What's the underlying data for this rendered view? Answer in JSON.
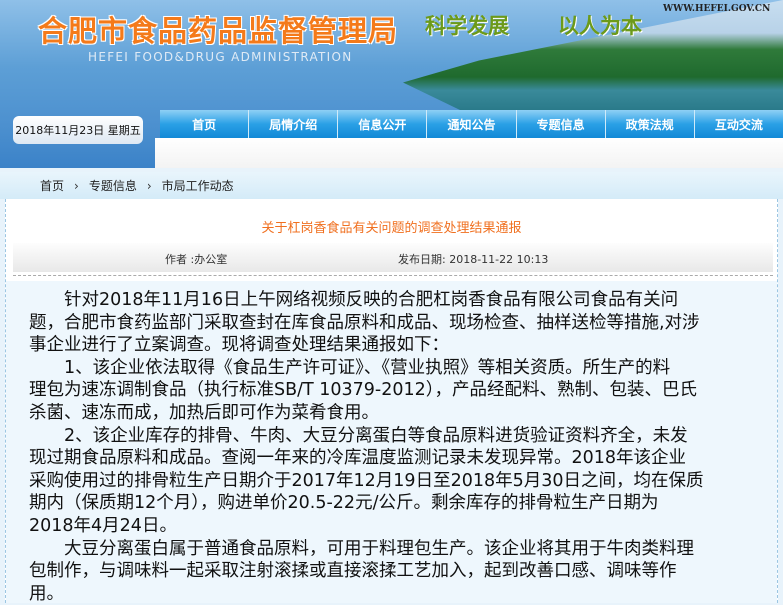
{
  "header": {
    "title": "合肥市食品药品监督管理局",
    "slogan1": "科学发展",
    "slogan2": "以人为本",
    "url": "WWW.HEFEI.GOV.CN",
    "english_title": "HEFEI FOOD&DRUG ADMINISTRATION",
    "date": "2018年11月23日 星期五"
  },
  "nav": [
    "首页",
    "局情介绍",
    "信息公开",
    "通知公告",
    "专题信息",
    "政策法规",
    "互动交流"
  ],
  "breadcrumb": {
    "items": [
      "首页",
      "专题信息",
      "市局工作动态"
    ],
    "separator": "›"
  },
  "article": {
    "title": "关于杠岗香食品有关问题的调查处理结果通报",
    "author": "作者 :办公室",
    "date": "发布日期: 2018-11-22 10:13",
    "lines": [
      "　　针对2018年11月16日上午网络视频反映的合肥杠岗香食品有限公司食品有关问",
      "题，合肥市食药监部门采取查封在库食品原料和成品、现场检查、抽样送检等措施,对涉",
      "事企业进行了立案调查。现将调查处理结果通报如下：",
      "　　1、该企业依法取得《食品生产许可证》、《营业执照》等相关资质。所生产的料",
      "理包为速冻调制食品（执行标准SB/T 10379-2012），产品经配料、熟制、包装、巴氏",
      "杀菌、速冻而成，加热后即可作为菜肴食用。",
      "　　2、该企业库存的排骨、牛肉、大豆分离蛋白等食品原料进货验证资料齐全，未发",
      "现过期食品原料和成品。查阅一年来的冷库温度监测记录未发现异常。2018年该企业",
      "采购使用过的排骨粒生产日期介于2017年12月19日至2018年5月30日之间，均在保质",
      "期内（保质期12个月），购进单价20.5-22元/公斤。剩余库存的排骨粒生产日期为",
      "2018年4月24日。",
      "　　大豆分离蛋白属于普通食品原料，可用于料理包生产。该企业将其用于牛肉类料理",
      "包制作，与调味料一起采取注射滚揉或直接滚揉工艺加入，起到改善口感、调味等作",
      "用。"
    ]
  }
}
